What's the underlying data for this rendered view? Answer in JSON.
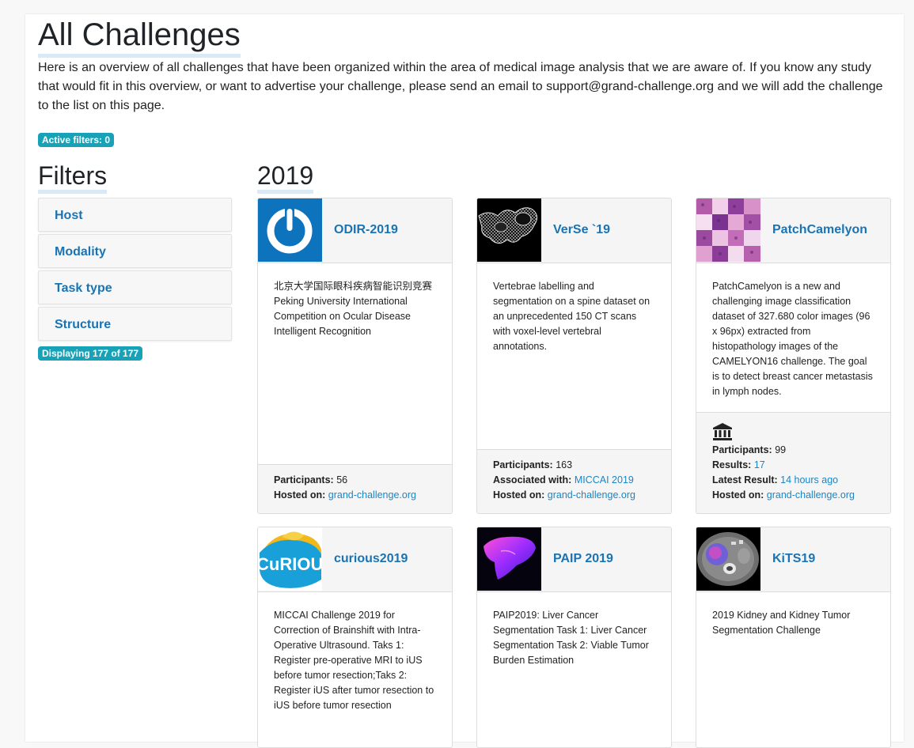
{
  "header": {
    "title": "All Challenges",
    "intro": "Here is an overview of all challenges that have been organized within the area of medical image analysis that we are aware of. If you know any study that would fit in this overview, or want to advertise your challenge, please send an email to support@grand-challenge.org and we will add the challenge to the list on this page."
  },
  "active_filters": "Active filters: 0",
  "filters": {
    "title": "Filters",
    "items": [
      "Host",
      "Modality",
      "Task type",
      "Structure"
    ],
    "displaying": "Displaying 177 of 177"
  },
  "year_heading": "2019",
  "labels": {
    "participants": "Participants:",
    "hosted_on": "Hosted on:",
    "associated_with": "Associated with:",
    "results": "Results:",
    "latest_result": "Latest Result:"
  },
  "colors": {
    "accent": "#1a74b4",
    "badge": "#17a2b8",
    "link": "#1a86c7"
  },
  "cards": [
    {
      "title": "ODIR-2019",
      "icon": "odir-power-logo",
      "description": "北京大学国际眼科疾病智能识别竞赛 Peking University International Competition on Ocular Disease Intelligent Recognition",
      "participants": "56",
      "hosted_on": "grand-challenge.org"
    },
    {
      "title": "VerSe `19",
      "icon": "spine-mesh-thumbnail",
      "description": "Vertebrae labelling and segmentation on a spine dataset on an unprecedented 150 CT scans with voxel-level vertebral annotations.",
      "participants": "163",
      "associated_with": "MICCAI 2019",
      "hosted_on": "grand-challenge.org"
    },
    {
      "title": "PatchCamelyon",
      "icon": "histopathology-patches-thumbnail",
      "description": "PatchCamelyon is a new and challenging image classification dataset of 327.680 color images (96 x 96px) extracted from histopathology images of the CAMELYON16 challenge. The goal is to detect breast cancer metastasis in lymph nodes.",
      "institution_icon": "institution-icon",
      "participants": "99",
      "results": "17",
      "latest_result": "14 hours ago",
      "hosted_on": "grand-challenge.org"
    },
    {
      "title": "curious2019",
      "icon": "curious-logo",
      "logo_text": "CuRIOUS",
      "description": "MICCAI Challenge 2019 for Correction of Brainshift with Intra-Operative Ultrasound. Taks 1: Register pre-operative MRI to iUS before tumor resection;Taks 2: Register iUS after tumor resection to iUS before tumor resection"
    },
    {
      "title": "PAIP 2019",
      "icon": "liver-thumbnail",
      "description": "PAIP2019: Liver Cancer Segmentation Task 1: Liver Cancer Segmentation Task 2: Viable Tumor Burden Estimation"
    },
    {
      "title": "KiTS19",
      "icon": "kidney-ct-thumbnail",
      "description": "2019 Kidney and Kidney Tumor Segmentation Challenge"
    }
  ]
}
